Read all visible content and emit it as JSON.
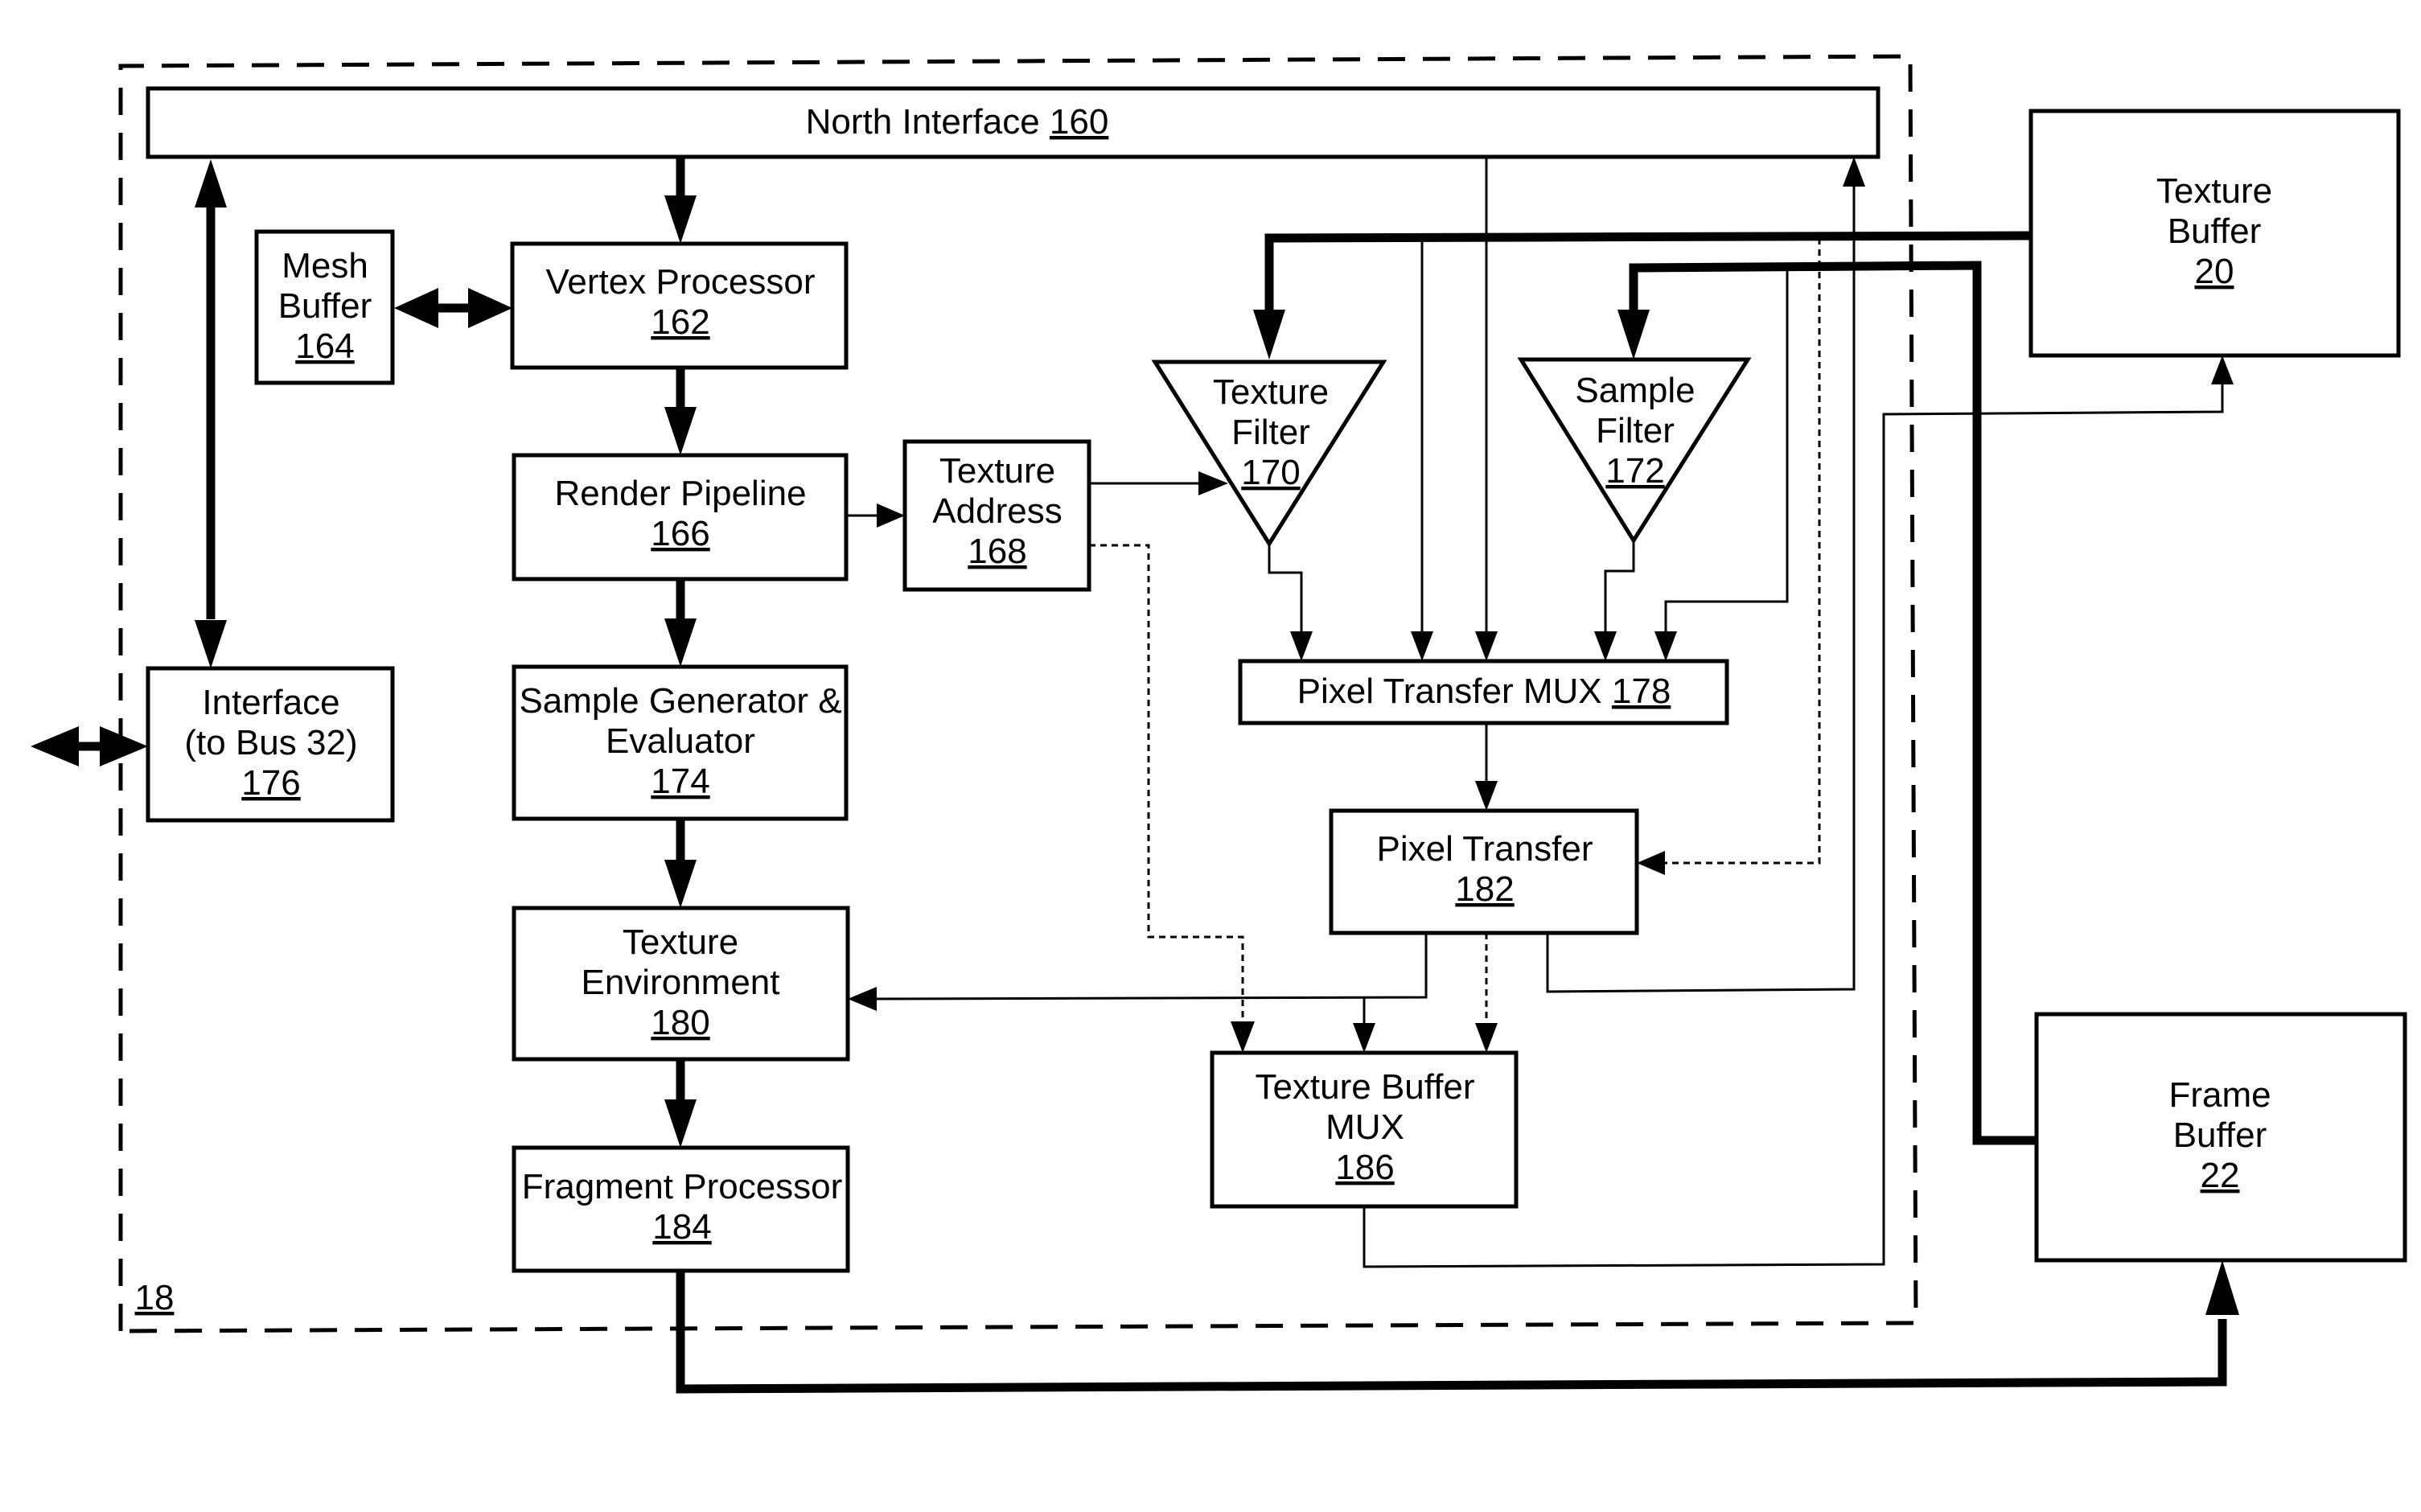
{
  "figure": {
    "boundary_label": "18",
    "blocks": {
      "north_interface": {
        "lines": [
          "North Interface"
        ],
        "ref": "160"
      },
      "mesh_buffer": {
        "lines": [
          "Mesh",
          "Buffer"
        ],
        "ref": "164"
      },
      "vertex_processor": {
        "lines": [
          "Vertex Processor"
        ],
        "ref": "162"
      },
      "render_pipeline": {
        "lines": [
          "Render Pipeline"
        ],
        "ref": "166"
      },
      "texture_address": {
        "lines": [
          "Texture",
          "Address"
        ],
        "ref": "168"
      },
      "texture_filter": {
        "lines": [
          "Texture",
          "Filter"
        ],
        "ref": "170"
      },
      "sample_filter": {
        "lines": [
          "Sample",
          "Filter"
        ],
        "ref": "172"
      },
      "pixel_transfer_mux": {
        "lines": [
          "Pixel Transfer MUX"
        ],
        "ref": "178"
      },
      "pixel_transfer": {
        "lines": [
          "Pixel Transfer"
        ],
        "ref": "182"
      },
      "interface": {
        "lines": [
          "Interface",
          "(to Bus 32)"
        ],
        "ref": "176"
      },
      "sample_generator": {
        "lines": [
          "Sample Generator &",
          "Evaluator"
        ],
        "ref": "174"
      },
      "texture_environment": {
        "lines": [
          "Texture",
          "Environment"
        ],
        "ref": "180"
      },
      "texture_buffer_mux": {
        "lines": [
          "Texture Buffer",
          "MUX"
        ],
        "ref": "186"
      },
      "fragment_processor": {
        "lines": [
          "Fragment Processor"
        ],
        "ref": "184"
      },
      "texture_buffer": {
        "lines": [
          "Texture",
          "Buffer"
        ],
        "ref": "20"
      },
      "frame_buffer": {
        "lines": [
          "Frame",
          "Buffer"
        ],
        "ref": "22"
      }
    }
  }
}
